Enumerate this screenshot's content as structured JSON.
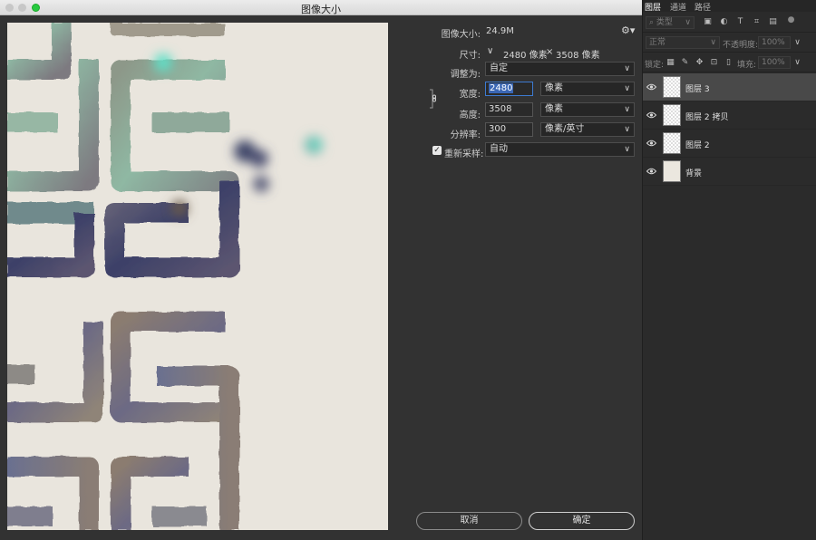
{
  "dialog": {
    "title": "图像大小",
    "image_size_label": "图像大小:",
    "image_size_value": "24.9M",
    "dimensions_label": "尺寸:",
    "dimensions_width": "2480 像素",
    "dimensions_sep": "×",
    "dimensions_height": "3508 像素",
    "fit_to_label": "调整为:",
    "fit_to_value": "自定",
    "width_label": "宽度:",
    "width_value": "2480",
    "width_unit": "像素",
    "height_label": "高度:",
    "height_value": "3508",
    "height_unit": "像素",
    "resolution_label": "分辨率:",
    "resolution_value": "300",
    "resolution_unit": "像素/英寸",
    "resample_label": "重新采样:",
    "resample_checked": true,
    "resample_value": "自动",
    "cancel_label": "取消",
    "ok_label": "确定"
  },
  "layers_panel": {
    "tabs": [
      "图层",
      "通道",
      "路径"
    ],
    "active_tab": "图层",
    "filter_placeholder": "类型",
    "blend_mode": "正常",
    "opacity_label": "不透明度:",
    "opacity_value": "100%",
    "lock_label": "锁定:",
    "fill_label": "填充:",
    "fill_value": "100%",
    "layers": [
      {
        "name": "图层 3",
        "active": true,
        "thumb": "checker"
      },
      {
        "name": "图层 2 拷贝",
        "active": false,
        "thumb": "checker"
      },
      {
        "name": "图层 2",
        "active": false,
        "thumb": "checker"
      },
      {
        "name": "背景",
        "active": false,
        "thumb": "bg"
      }
    ]
  },
  "colors": {
    "canvas": "#e9e5dd",
    "selection": "#3b67b5",
    "paint_dark": "#3a3e63",
    "paint_mint": "#7fd8c3",
    "paint_taupe": "#8b7e76"
  }
}
